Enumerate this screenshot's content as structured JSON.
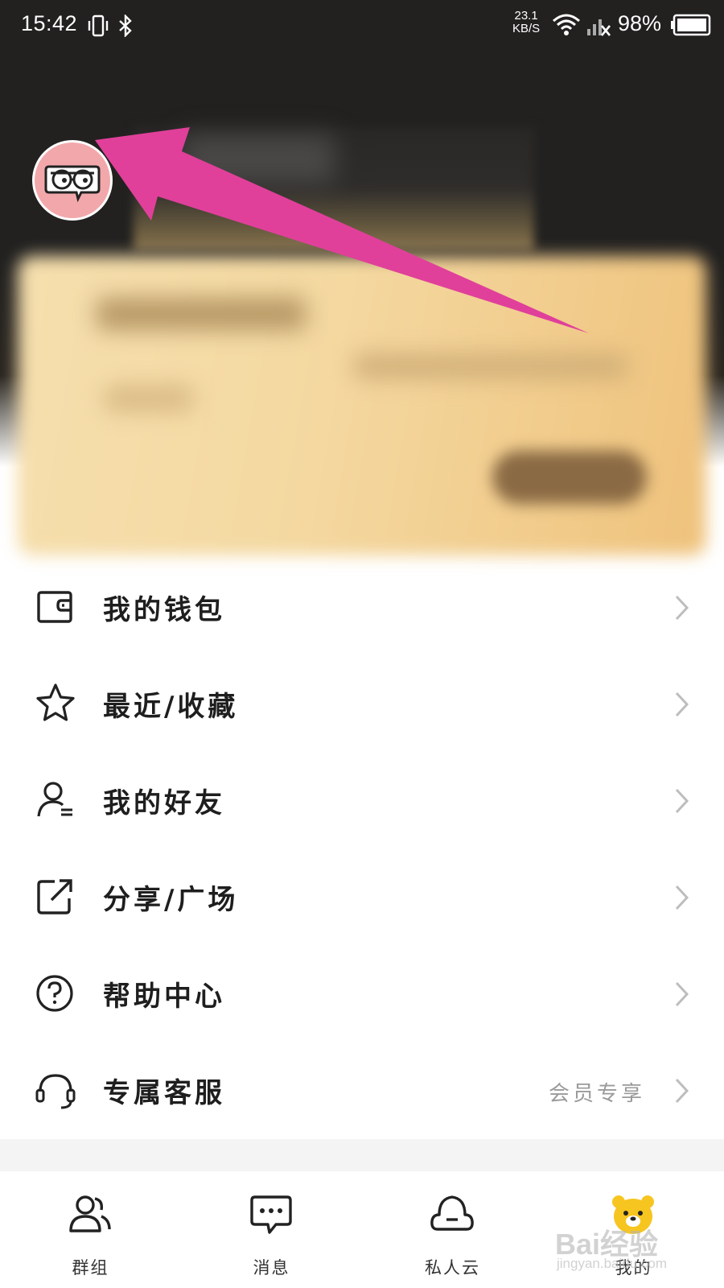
{
  "status_bar": {
    "time": "15:42",
    "net_speed_value": "23.1",
    "net_speed_unit": "KB/S",
    "battery_percent": "98%"
  },
  "profile": {
    "avatar_icon": "glasses-chat-avatar",
    "avatar_color": "#f2a8ab"
  },
  "menu": {
    "items": [
      {
        "label": "我的钱包",
        "icon": "wallet-icon"
      },
      {
        "label": "最近/收藏",
        "icon": "star-icon"
      },
      {
        "label": "我的好友",
        "icon": "person-list-icon"
      },
      {
        "label": "分享/广场",
        "icon": "share-out-icon"
      },
      {
        "label": "帮助中心",
        "icon": "question-circle-icon"
      },
      {
        "label": "专属客服",
        "icon": "headset-icon",
        "extra": "会员专享"
      }
    ]
  },
  "tabbar": {
    "tabs": [
      {
        "label": "群组",
        "icon": "group-icon"
      },
      {
        "label": "消息",
        "icon": "message-icon"
      },
      {
        "label": "私人云",
        "icon": "cloud-icon"
      },
      {
        "label": "我的",
        "icon": "bear-icon",
        "active": true
      }
    ]
  },
  "colors": {
    "header_bg": "#222120",
    "annotation_arrow": "#e0409a",
    "card_gold": "#f4d8a0",
    "active_tab_icon": "#f7c520"
  },
  "watermark": {
    "brand": "Bai经验",
    "url": "jingyan.baidu.com"
  }
}
